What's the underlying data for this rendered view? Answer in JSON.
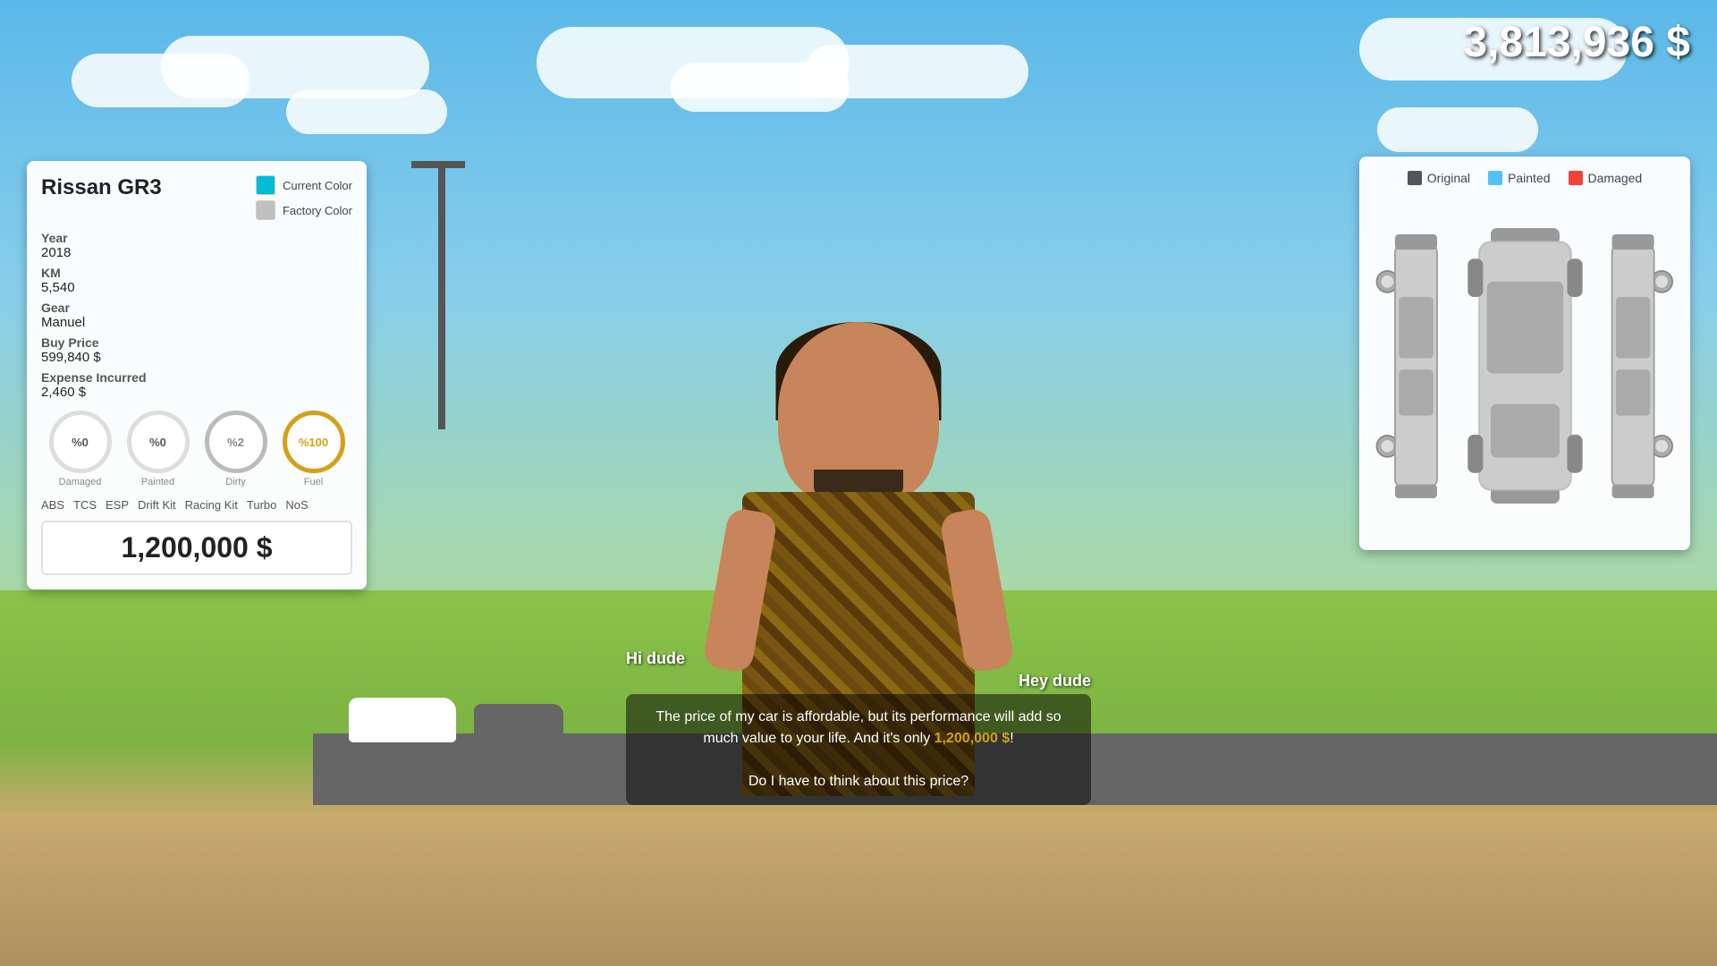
{
  "money": {
    "amount": "3,813,936 $"
  },
  "car": {
    "name": "Rissan GR3",
    "year_label": "Year",
    "year": "2018",
    "km_label": "KM",
    "km": "5,540",
    "gear_label": "Gear",
    "gear": "Manuel",
    "buy_price_label": "Buy Price",
    "buy_price": "599,840 $",
    "expense_label": "Expense Incurred",
    "expense": "2,460 $",
    "colors": {
      "current_label": "Current Color",
      "factory_label": "Factory Color"
    },
    "gauges": [
      {
        "id": "damaged",
        "value": "%0",
        "label": "Damaged"
      },
      {
        "id": "painted",
        "value": "%0",
        "label": "Painted"
      },
      {
        "id": "dirty",
        "value": "%2",
        "label": "Dirty"
      },
      {
        "id": "fuel",
        "value": "%100",
        "label": "Fuel"
      }
    ],
    "addons": [
      "ABS",
      "TCS",
      "ESP",
      "Drift Kit",
      "Racing Kit",
      "Turbo",
      "NoS"
    ],
    "sale_price": "1,200,000 $"
  },
  "diagram": {
    "legend": [
      {
        "id": "original",
        "label": "Original"
      },
      {
        "id": "painted",
        "label": "Painted"
      },
      {
        "id": "damaged",
        "label": "Damaged"
      }
    ]
  },
  "dialog": {
    "speaker_left": "Hi dude",
    "speaker_right": "Hey dude",
    "main_text": "The price of my car is affordable, but its performance will add so much value to your life. And it's only 1,200,000 $!",
    "highlight": "1,200,000 $",
    "question": "Do I have to think about this price?"
  }
}
